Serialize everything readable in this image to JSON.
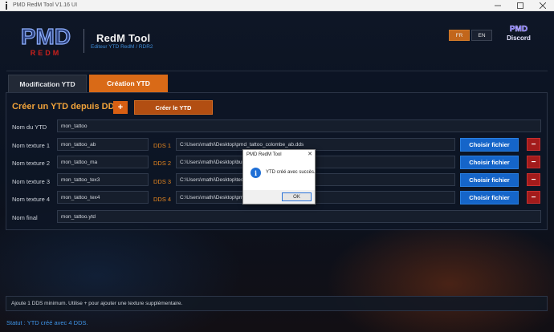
{
  "window": {
    "title": "PMD RedM Tool V1.16 UI",
    "minimize_icon": "minimize-icon",
    "maximize_icon": "maximize-icon",
    "close_icon": "close-icon"
  },
  "header": {
    "logo_text_top": "PMD",
    "logo_text_bottom": "REDM",
    "app_name": "RedM Tool",
    "app_subtitle": "Editeur YTD RedM / RDR2",
    "lang_fr": "FR",
    "lang_en": "EN",
    "discord_top": "PMD",
    "discord_label": "Discord"
  },
  "tabs": [
    {
      "label": "Modification YTD",
      "active": false
    },
    {
      "label": "Création YTD",
      "active": true
    }
  ],
  "panel": {
    "title": "Créer un YTD depuis DDS",
    "add_label": "+",
    "create_label": "Créer le YTD",
    "ytd_name_label": "Nom du YTD",
    "ytd_name_value": "mon_tattoo",
    "textures": [
      {
        "label": "Nom texture 1",
        "name": "mon_tattoo_ab",
        "dds_label": "DDS 1",
        "path": "C:\\Users\\mathi\\Desktop\\pmd_tattoo_colombe_ab.dds",
        "choose_label": "Choisir fichier",
        "remove_label": "−"
      },
      {
        "label": "Nom texture 2",
        "name": "mon_tattoo_ma",
        "dds_label": "DDS 2",
        "path": "C:\\Users\\mathi\\Desktop\\bum",
        "choose_label": "Choisir fichier",
        "remove_label": "−"
      },
      {
        "label": "Nom texture 3",
        "name": "mon_tattoo_tex3",
        "dds_label": "DDS 3",
        "path": "C:\\Users\\mathi\\Desktop\\test",
        "choose_label": "Choisir fichier",
        "remove_label": "−"
      },
      {
        "label": "Nom texture 4",
        "name": "mon_tattoo_tex4",
        "dds_label": "DDS 4",
        "path": "C:\\Users\\mathi\\Desktop\\pmd",
        "choose_label": "Choisir fichier",
        "remove_label": "−"
      }
    ],
    "final_name_label": "Nom final",
    "final_name_value": "mon_tattoo.ytd"
  },
  "info_text": "Ajoute 1 DDS minimum. Utilise + pour ajouter une texture supplémentaire.",
  "status_text": "Statut : YTD créé avec 4 DDS.",
  "dialog": {
    "title": "PMD RedM Tool",
    "close_glyph": "✕",
    "icon_glyph": "i",
    "message": "YTD créé avec succès.",
    "ok_label": "OK"
  },
  "colors": {
    "accent_orange": "#d96a17",
    "accent_blue": "#1565c9",
    "remove_red": "#a31b1b",
    "title_orange": "#f0a23a",
    "status_blue": "#3f94e6"
  }
}
